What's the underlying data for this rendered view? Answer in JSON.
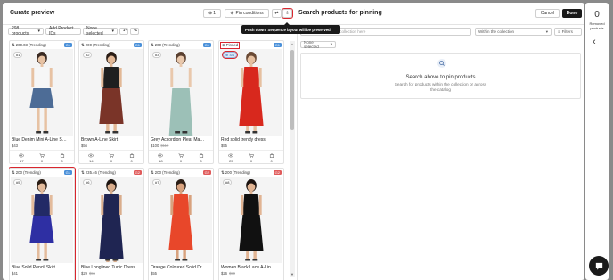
{
  "header": {
    "title": "Curate preview",
    "pin_count": "1",
    "pin_conditions_label": "Pin conditions",
    "right_title": "Search products for pinning",
    "cancel_label": "Cancel",
    "done_label": "Done"
  },
  "tooltip": "Push down: Sequence layout will be preserved",
  "toolbar": {
    "products_select": "298 products",
    "add_ids_label": "Add Product IDs",
    "none_selected": "None selected"
  },
  "search": {
    "placeholder": "Search within the collection here",
    "scope_select": "Within the collection",
    "filters_label": "Filters",
    "none_selected": "None selected",
    "empty_title": "Search above to pin products",
    "empty_line1": "Search for products within the collection or across",
    "empty_line2": "the catalog"
  },
  "sidebar": {
    "removed_count": "0",
    "removed_label_line1": "Removed",
    "removed_label_line2": "products"
  },
  "products": [
    {
      "score": "200.03 (Trending)",
      "badge": "G1",
      "badge_color": "#4a90d9",
      "rank": "#1",
      "name": "Blue Denim Mini A-Line S…",
      "price": "$43",
      "old_price": "",
      "views": "17",
      "carts": "0",
      "buys": "0",
      "outfit": "denim"
    },
    {
      "score": "200 (Trending)",
      "badge": "G1",
      "badge_color": "#4a90d9",
      "rank": "#2",
      "name": "Brown A-Line Skirt",
      "price": "$56",
      "old_price": "",
      "views": "14",
      "carts": "0",
      "buys": "0",
      "outfit": "brown"
    },
    {
      "score": "200 (Trending)",
      "badge": "G1",
      "badge_color": "#4a90d9",
      "rank": "#3",
      "name": "Grey Accordion Pleat Ma…",
      "price": "$100",
      "old_price": "$110",
      "views": "18",
      "carts": "0",
      "buys": "0",
      "outfit": "pleat"
    },
    {
      "score": "Pinned",
      "badge": "G1",
      "badge_color": "#4a90d9",
      "rank": "4/4",
      "name": "Red solid trendy dress",
      "price": "$55",
      "old_price": "",
      "views": "25",
      "carts": "0",
      "buys": "0",
      "outfit": "red"
    },
    {
      "score": "200 (Trending)",
      "badge": "G1",
      "badge_color": "#4a90d9",
      "rank": "#5",
      "name": "Blue Solid Pencil Skirt",
      "price": "$41",
      "old_price": "",
      "views": "",
      "carts": "",
      "buys": "",
      "outfit": "pencil"
    },
    {
      "score": "235.46 (Trending)",
      "badge": "G2",
      "badge_color": "#e05b5b",
      "rank": "#6",
      "name": "Blue Longlined Tunic Dress",
      "price": "$29",
      "old_price": "$55",
      "views": "",
      "carts": "",
      "buys": "",
      "outfit": "tunic"
    },
    {
      "score": "200 (Trending)",
      "badge": "G2",
      "badge_color": "#e05b5b",
      "rank": "#7",
      "name": "Orange Coloured Solid Dr…",
      "price": "$55",
      "old_price": "",
      "views": "",
      "carts": "",
      "buys": "",
      "outfit": "orange"
    },
    {
      "score": "200 (Trending)",
      "badge": "G2",
      "badge_color": "#e05b5b",
      "rank": "#8",
      "name": "Women Black Lace A-Lin…",
      "price": "$26",
      "old_price": "$50",
      "views": "",
      "carts": "",
      "buys": "",
      "outfit": "black"
    }
  ]
}
